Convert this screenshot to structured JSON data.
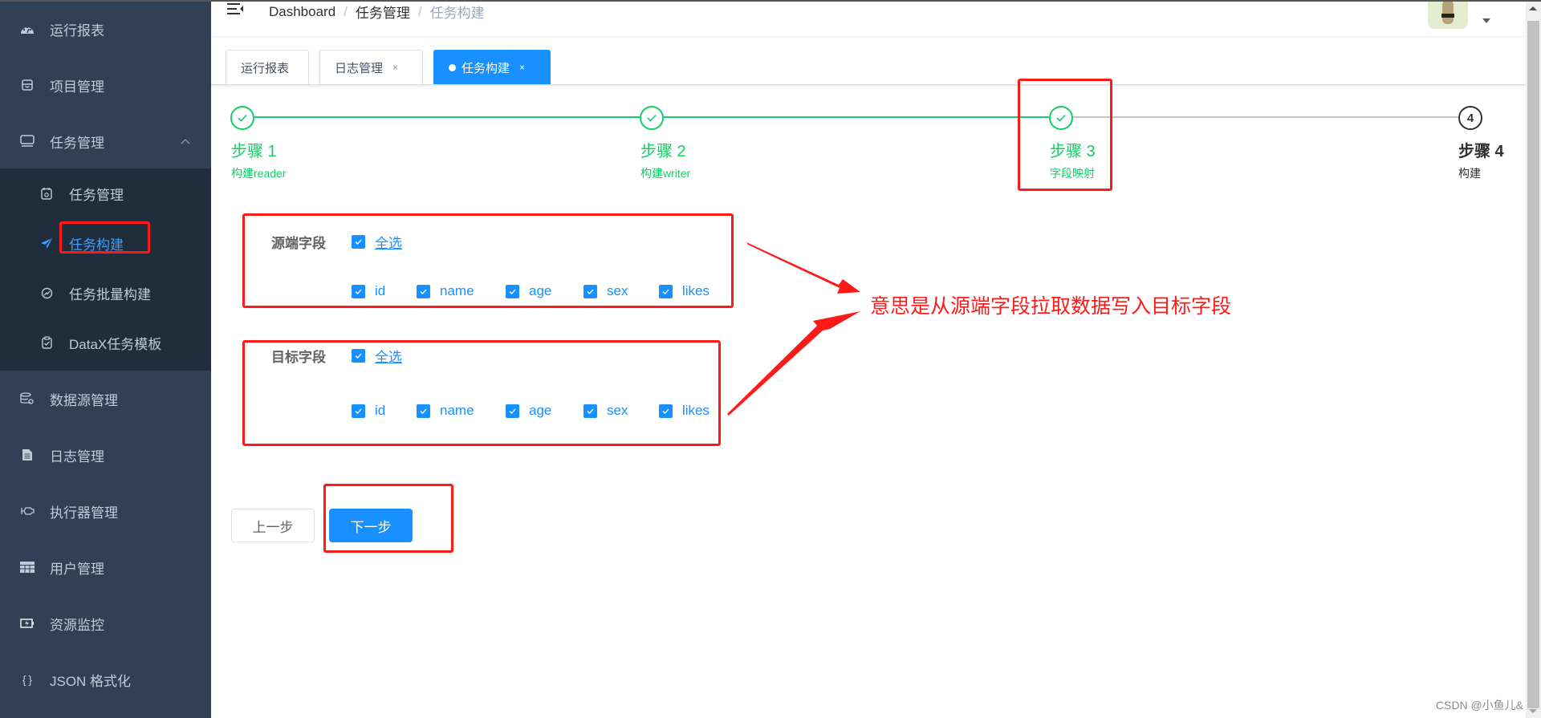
{
  "sidebar": {
    "items": [
      {
        "label": "运行报表",
        "icon": "dashboard-icon"
      },
      {
        "label": "项目管理",
        "icon": "project-icon"
      },
      {
        "label": "任务管理",
        "icon": "monitor-icon",
        "expanded": true
      },
      {
        "label": "数据源管理",
        "icon": "database-icon"
      },
      {
        "label": "日志管理",
        "icon": "document-icon"
      },
      {
        "label": "执行器管理",
        "icon": "executor-icon"
      },
      {
        "label": "用户管理",
        "icon": "table-icon"
      },
      {
        "label": "资源监控",
        "icon": "battery-icon"
      },
      {
        "label": "JSON 格式化",
        "icon": "braces-icon"
      }
    ],
    "submenu": [
      {
        "label": "任务管理",
        "icon": "calendar-icon"
      },
      {
        "label": "任务构建",
        "icon": "paper-plane-icon",
        "active": true
      },
      {
        "label": "任务批量构建",
        "icon": "batch-icon"
      },
      {
        "label": "DataX任务模板",
        "icon": "clipboard-icon"
      }
    ]
  },
  "header": {
    "breadcrumb": [
      "Dashboard",
      "任务管理",
      "任务构建"
    ],
    "separator": "/"
  },
  "tags": [
    {
      "label": "运行报表",
      "closable": false,
      "active": false
    },
    {
      "label": "日志管理",
      "closable": true,
      "active": false
    },
    {
      "label": "任务构建",
      "closable": true,
      "active": true
    }
  ],
  "tag_close": "×",
  "steps": [
    {
      "title": "步骤 1",
      "description": "构建reader",
      "status": "finish",
      "number": "1"
    },
    {
      "title": "步骤 2",
      "description": "构建writer",
      "status": "finish",
      "number": "2"
    },
    {
      "title": "步骤 3",
      "description": "字段映射",
      "status": "finish",
      "number": "3"
    },
    {
      "title": "步骤 4",
      "description": "构建",
      "status": "wait",
      "number": "4"
    }
  ],
  "form": {
    "source": {
      "label": "源端字段",
      "select_all": "全选",
      "select_all_checked": true,
      "fields": [
        {
          "name": "id",
          "checked": true
        },
        {
          "name": "name",
          "checked": true
        },
        {
          "name": "age",
          "checked": true
        },
        {
          "name": "sex",
          "checked": true
        },
        {
          "name": "likes",
          "checked": true
        }
      ]
    },
    "target": {
      "label": "目标字段",
      "select_all": "全选",
      "select_all_checked": true,
      "fields": [
        {
          "name": "id",
          "checked": true
        },
        {
          "name": "name",
          "checked": true
        },
        {
          "name": "age",
          "checked": true
        },
        {
          "name": "sex",
          "checked": true
        },
        {
          "name": "likes",
          "checked": true
        }
      ]
    }
  },
  "buttons": {
    "prev": "上一步",
    "next": "下一步"
  },
  "annotation": {
    "text": "意思是从源端字段拉取数据写入目标字段",
    "color": "#ff1a1a"
  },
  "colors": {
    "primary": "#1890ff",
    "success": "#13ce66",
    "sidebar_bg": "#304156",
    "submenu_bg": "#1f2d3d"
  },
  "watermark": "CSDN @小鱼儿&"
}
